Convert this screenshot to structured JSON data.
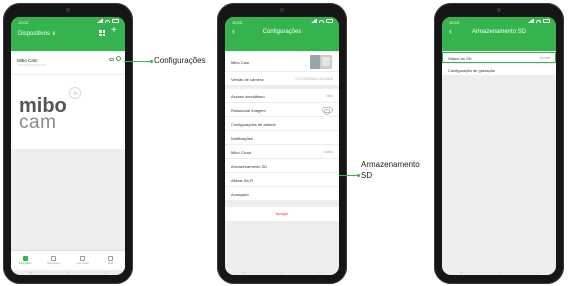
{
  "phone1": {
    "status_time": "10:03",
    "header_title": "Dispositivos ∨",
    "camera_name": "Mibo Cam",
    "logo_line1": "mibo",
    "logo_line2": "cam",
    "nav": [
      {
        "label": "Dispositivo",
        "active": true
      },
      {
        "label": "Mensagem",
        "active": false
      },
      {
        "label": "Loja virtual",
        "active": false
      },
      {
        "label": "Mais",
        "active": false
      }
    ]
  },
  "phone2": {
    "status_time": "10:03",
    "title": "Configurações",
    "rows": [
      {
        "label": "Mibo Cam",
        "value": ""
      },
      {
        "label": "Versão de câmera",
        "value": "2.3.0.003K004.0.0.210624"
      },
      {
        "label": "Acesso simultâneo",
        "value": "Visto"
      },
      {
        "label": "Rotacionar imagem",
        "value": ""
      },
      {
        "label": "Configurações de alarme",
        "value": ""
      },
      {
        "label": "Notificações",
        "value": ""
      },
      {
        "label": "Mibo Cloud",
        "value": "Inativo"
      },
      {
        "label": "Armazenamento SD",
        "value": ""
      },
      {
        "label": "Alterar Wi-Fi",
        "value": ""
      },
      {
        "label": "Avançado",
        "value": ""
      }
    ],
    "delete_label": "Apagar"
  },
  "phone3": {
    "status_time": "10:03",
    "title": "Armazenamento SD",
    "rows": [
      {
        "label": "Status do SD",
        "value": "Normal"
      },
      {
        "label": "Configuração de gravação",
        "value": ""
      }
    ]
  },
  "android_nav": [
    "◁",
    "○",
    "□"
  ],
  "callouts": {
    "configuracoes": "Configurações",
    "armazenamento_line1": "Armazenamento",
    "armazenamento_line2": "SD"
  },
  "colors": {
    "accent": "#35b34d",
    "delete": "#e04a3a"
  }
}
